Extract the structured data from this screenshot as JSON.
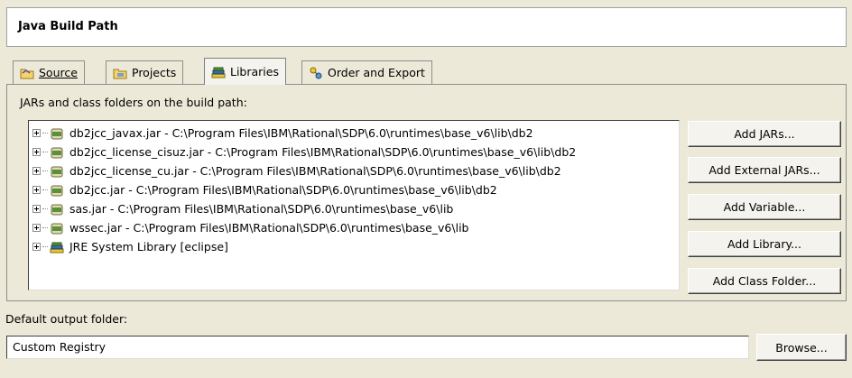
{
  "title": "Java Build Path",
  "tabs": [
    {
      "label": "Source",
      "icon": "source-folder-icon"
    },
    {
      "label": "Projects",
      "icon": "projects-folder-icon"
    },
    {
      "label": "Libraries",
      "icon": "libraries-icon"
    },
    {
      "label": "Order and Export",
      "icon": "order-export-icon"
    }
  ],
  "active_tab": "Libraries",
  "libraries": {
    "label": "JARs and class folders on the build path:",
    "entries": [
      {
        "text": "db2jcc_javax.jar - C:\\Program Files\\IBM\\Rational\\SDP\\6.0\\runtimes\\base_v6\\lib\\db2",
        "icon": "jar-icon"
      },
      {
        "text": "db2jcc_license_cisuz.jar - C:\\Program Files\\IBM\\Rational\\SDP\\6.0\\runtimes\\base_v6\\lib\\db2",
        "icon": "jar-icon"
      },
      {
        "text": "db2jcc_license_cu.jar - C:\\Program Files\\IBM\\Rational\\SDP\\6.0\\runtimes\\base_v6\\lib\\db2",
        "icon": "jar-icon"
      },
      {
        "text": "db2jcc.jar - C:\\Program Files\\IBM\\Rational\\SDP\\6.0\\runtimes\\base_v6\\lib\\db2",
        "icon": "jar-icon"
      },
      {
        "text": "sas.jar - C:\\Program Files\\IBM\\Rational\\SDP\\6.0\\runtimes\\base_v6\\lib",
        "icon": "jar-icon"
      },
      {
        "text": "wssec.jar - C:\\Program Files\\IBM\\Rational\\SDP\\6.0\\runtimes\\base_v6\\lib",
        "icon": "jar-icon"
      },
      {
        "text": "JRE System Library [eclipse]",
        "icon": "library-icon"
      }
    ]
  },
  "buttons": {
    "add_jars": "Add JARs...",
    "add_external_jars": "Add External JARs...",
    "add_variable": "Add Variable...",
    "add_library": "Add Library...",
    "add_class_folder": "Add Class Folder..."
  },
  "output": {
    "label": "Default output folder:",
    "value": "Custom Registry",
    "browse": "Browse..."
  },
  "colors": {
    "background": "#ece9d8",
    "list_background": "#ffffff",
    "jar_icon_green": "#5a8f3c",
    "library_icon_yellow": "#e8c830"
  }
}
